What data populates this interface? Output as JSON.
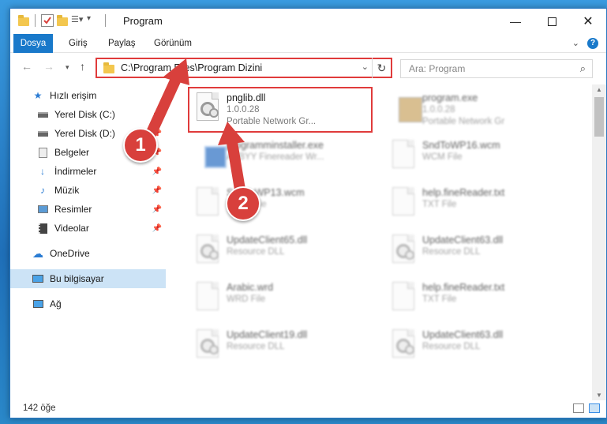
{
  "window": {
    "title": "Program"
  },
  "ribbon": {
    "tabs": [
      "Dosya",
      "Giriş",
      "Paylaş",
      "Görünüm"
    ]
  },
  "navbar": {
    "address_path": "C:\\Program Files\\Program Dizini",
    "search_placeholder": "Ara: Program"
  },
  "sidebar": {
    "items": [
      {
        "label": "Hızlı erişim",
        "icon": "star-icon"
      },
      {
        "label": "Yerel Disk (C:)",
        "icon": "drive-icon",
        "pinned": true
      },
      {
        "label": "Yerel Disk (D:)",
        "icon": "drive-icon",
        "pinned": true
      },
      {
        "label": "Belgeler",
        "icon": "documents-icon",
        "pinned": true
      },
      {
        "label": "İndirmeler",
        "icon": "download-icon",
        "pinned": true
      },
      {
        "label": "Müzik",
        "icon": "music-icon",
        "pinned": true
      },
      {
        "label": "Resimler",
        "icon": "pictures-icon",
        "pinned": true
      },
      {
        "label": "Videolar",
        "icon": "videos-icon",
        "pinned": true
      },
      {
        "label": "OneDrive",
        "icon": "cloud-icon"
      },
      {
        "label": "Bu bilgisayar",
        "icon": "computer-icon",
        "active": true
      },
      {
        "label": "Ağ",
        "icon": "network-icon"
      }
    ]
  },
  "files": {
    "highlighted": {
      "name": "pnglib.dll",
      "version": "1.0.0.28",
      "type": "Portable Network Gr..."
    },
    "others": [
      {
        "name": "program.exe",
        "version": "1.0.0.28",
        "type": "Portable Network Gr",
        "icon": "program-icon"
      },
      {
        "name": "programminstaller.exe",
        "type": "ABBYY Finereader Wr...",
        "icon": "installer-icon"
      },
      {
        "name": "SndToWP16.wcm",
        "type": "WCM File",
        "icon": "doc-icon"
      },
      {
        "name": "SndToWP13.wcm",
        "type": "WCM File",
        "icon": "doc-icon"
      },
      {
        "name": "help.fineReader.txt",
        "type": "TXT File",
        "icon": "doc-icon"
      },
      {
        "name": "UpdateClient65.dll",
        "type": "Resource DLL",
        "icon": "dll-icon"
      },
      {
        "name": "UpdateClient63.dll",
        "type": "Resource DLL",
        "icon": "dll-icon"
      },
      {
        "name": "Arabic.wrd",
        "type": "WRD File",
        "icon": "doc-icon"
      },
      {
        "name": "help.fineReader.txt",
        "type": "TXT File",
        "icon": "doc-icon"
      },
      {
        "name": "UpdateClient19.dll",
        "type": "Resource DLL",
        "icon": "dll-icon"
      },
      {
        "name": "UpdateClient63.dll",
        "type": "Resource DLL",
        "icon": "dll-icon"
      }
    ]
  },
  "status": {
    "count": "142 öğe"
  },
  "annotations": {
    "step1": "1",
    "step2": "2",
    "color": "#d8403c"
  }
}
